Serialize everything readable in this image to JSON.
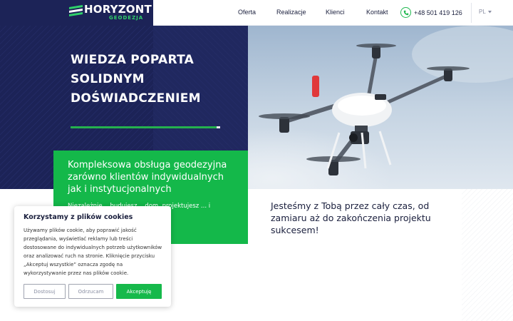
{
  "brand": {
    "name": "HORYZONT",
    "subtitle": "GEODEZJA",
    "colors": {
      "navy": "#1c2357",
      "green": "#14b84a"
    }
  },
  "nav": {
    "items": [
      "Oferta",
      "Realizacje",
      "Klienci",
      "Kontakt"
    ],
    "phone": "+48 501 419 126",
    "language": "PL"
  },
  "hero": {
    "title_lines": [
      "WIEDZA POPARTA",
      "SOLIDNYM",
      "DOŚWIADCZENIEM"
    ],
    "image_description_icon": "drone-photo"
  },
  "green_box": {
    "heading": "Kompleksowa obsługa geodezyjna zarówno klientów indywidualnych jak i instytucjonalnych",
    "text_visible": "Niezależnie... budujesz... dom, projektujesz ... i przygotowujesz ... montujesz"
  },
  "tagline": "Jesteśmy z Tobą przez cały czas, od zamiaru aż do zakończenia projektu sukcesem!",
  "cookie": {
    "title": "Korzystamy z plików cookies",
    "text": "Używamy plików cookie, aby poprawić jakość przeglądania, wyświetlać reklamy lub treści dostosowane do indywidualnych potrzeb użytkowników oraz analizować ruch na stronie. Kliknięcie przycisku „Akceptuj wszystkie” oznacza zgodę na wykorzystywanie przez nas plików cookie.",
    "buttons": {
      "customize": "Dostosuj",
      "reject": "Odrzucam",
      "accept": "Akceptuję"
    }
  }
}
